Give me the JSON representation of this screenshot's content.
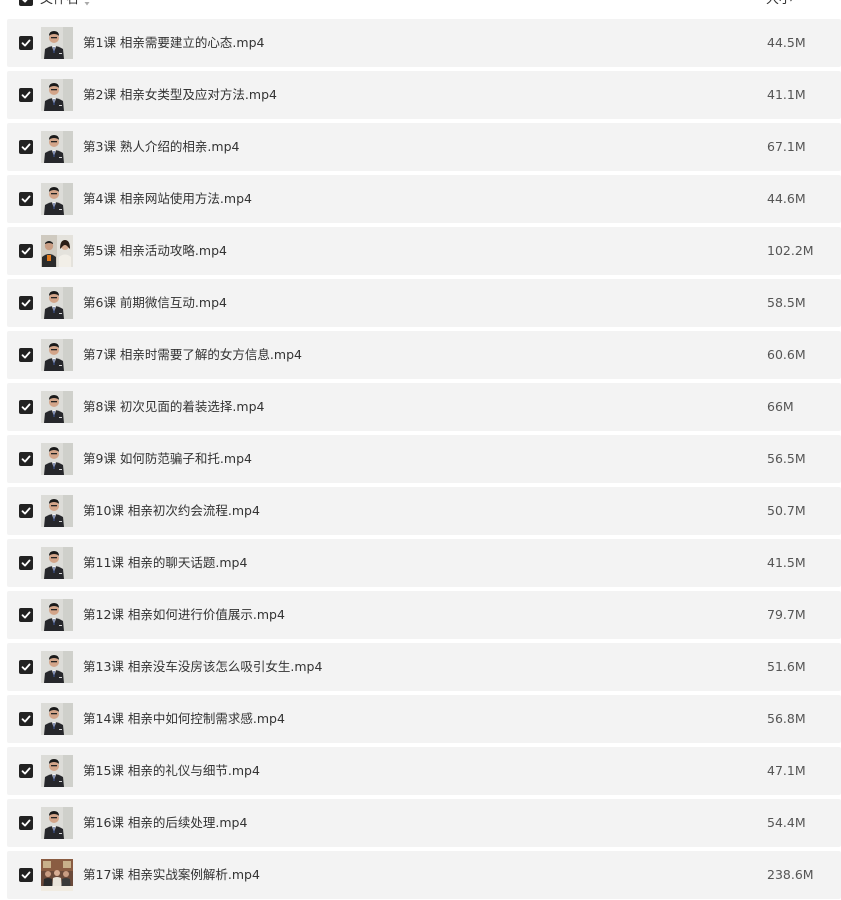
{
  "header": {
    "name_label": "文件名",
    "size_label": "大小"
  },
  "files": [
    {
      "name": "第1课 相亲需要建立的心态.mp4",
      "size": "44.5M",
      "thumb": "man-portrait"
    },
    {
      "name": "第2课 相亲女类型及应对方法.mp4",
      "size": "41.1M",
      "thumb": "man-portrait"
    },
    {
      "name": "第3课 熟人介绍的相亲.mp4",
      "size": "67.1M",
      "thumb": "man-portrait"
    },
    {
      "name": "第4课 相亲网站使用方法.mp4",
      "size": "44.6M",
      "thumb": "man-portrait"
    },
    {
      "name": "第5课 相亲活动攻略.mp4",
      "size": "102.2M",
      "thumb": "two-people"
    },
    {
      "name": "第6课 前期微信互动.mp4",
      "size": "58.5M",
      "thumb": "man-portrait"
    },
    {
      "name": "第7课 相亲时需要了解的女方信息.mp4",
      "size": "60.6M",
      "thumb": "man-portrait"
    },
    {
      "name": "第8课 初次见面的着装选择.mp4",
      "size": "66M",
      "thumb": "man-portrait"
    },
    {
      "name": "第9课 如何防范骗子和托.mp4",
      "size": "56.5M",
      "thumb": "man-portrait"
    },
    {
      "name": "第10课 相亲初次约会流程.mp4",
      "size": "50.7M",
      "thumb": "man-portrait"
    },
    {
      "name": "第11课 相亲的聊天话题.mp4",
      "size": "41.5M",
      "thumb": "man-portrait"
    },
    {
      "name": "第12课 相亲如何进行价值展示.mp4",
      "size": "79.7M",
      "thumb": "man-portrait"
    },
    {
      "name": "第13课 相亲没车没房该怎么吸引女生.mp4",
      "size": "51.6M",
      "thumb": "man-portrait"
    },
    {
      "name": "第14课 相亲中如何控制需求感.mp4",
      "size": "56.8M",
      "thumb": "man-portrait"
    },
    {
      "name": "第15课 相亲的礼仪与细节.mp4",
      "size": "47.1M",
      "thumb": "man-portrait"
    },
    {
      "name": "第16课 相亲的后续处理.mp4",
      "size": "54.4M",
      "thumb": "man-portrait"
    },
    {
      "name": "第17课 相亲实战案例解析.mp4",
      "size": "238.6M",
      "thumb": "group-scene"
    }
  ],
  "colors": {
    "row_bg": "#f3f3f3",
    "checkbox": "#222222"
  }
}
